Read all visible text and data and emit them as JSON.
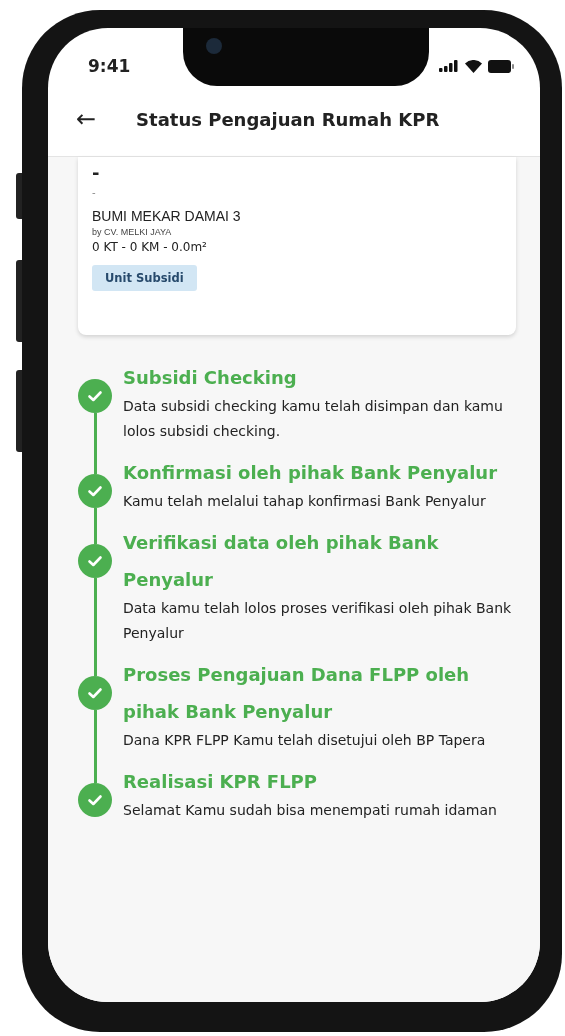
{
  "status_bar": {
    "time": "9:41"
  },
  "header": {
    "back": "←",
    "title": "Status Pengajuan Rumah KPR"
  },
  "unit_card": {
    "price": "-",
    "subtitle": "-",
    "name": "BUMI MEKAR DAMAI 3",
    "developer": "by CV. MELKI JAYA",
    "specs": "0 KT - 0 KM - 0.0m²",
    "tag": "Unit Subsidi"
  },
  "steps": [
    {
      "title": "Subsidi Checking",
      "description": "Data subsidi checking kamu telah disimpan dan kamu lolos subsidi checking.",
      "done": true
    },
    {
      "title": "Konfirmasi oleh pihak Bank Penyalur",
      "description": "Kamu telah melalui tahap konfirmasi Bank Penyalur",
      "done": true
    },
    {
      "title": "Verifikasi data oleh pihak Bank Penyalur",
      "description": "Data kamu telah lolos proses verifikasi oleh pihak Bank Penyalur",
      "done": true
    },
    {
      "title": "Proses Pengajuan Dana FLPP oleh pihak Bank Penyalur",
      "description": "Dana KPR FLPP Kamu telah disetujui oleh BP Tapera",
      "done": true
    },
    {
      "title": "Realisasi KPR FLPP",
      "description": "Selamat Kamu sudah bisa menempati rumah idaman",
      "done": true
    }
  ]
}
